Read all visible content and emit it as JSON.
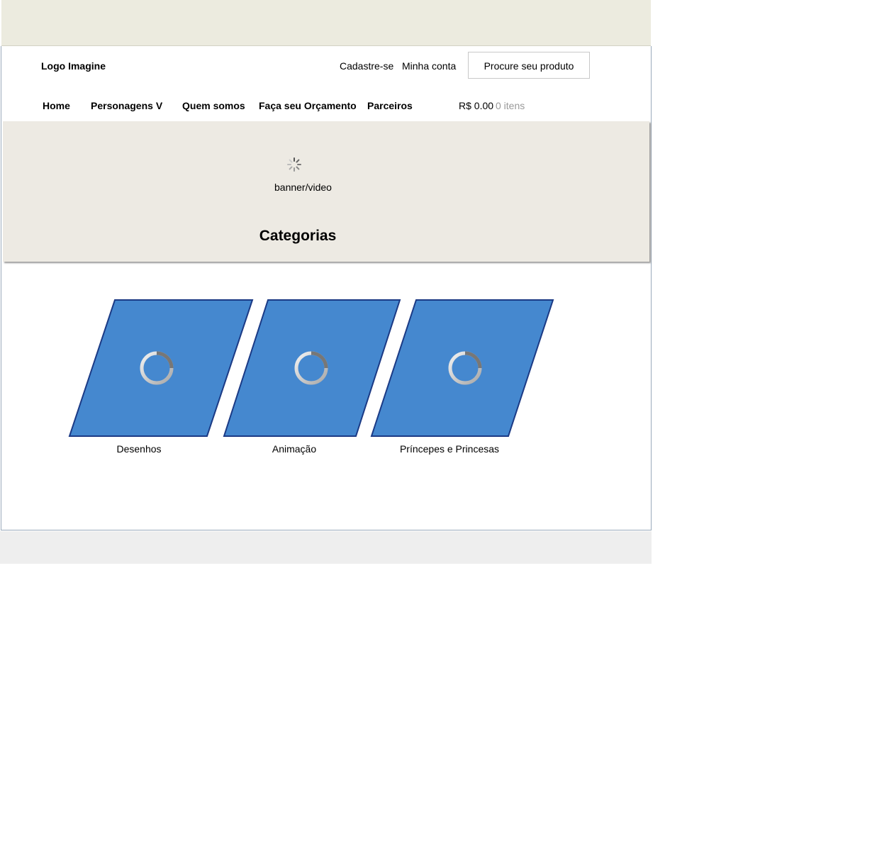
{
  "header": {
    "logo": "Logo Imagine",
    "links": {
      "signup": "Cadastre-se",
      "account": "Minha conta"
    },
    "search_placeholder": "Procure seu produto"
  },
  "nav": {
    "items": [
      "Home",
      "Personagens V",
      "Quem somos",
      "Faça seu Orçamento",
      "Parceiros"
    ],
    "cart_total": "R$ 0.00",
    "cart_count": "0 itens"
  },
  "banner": {
    "label": "banner/video"
  },
  "categories": {
    "title": "Categorias",
    "items": [
      "Desenhos",
      "Animação",
      "Príncepes e Princesas"
    ]
  },
  "colors": {
    "tile_fill": "#4588cf",
    "tile_border": "#1b3a85",
    "topbar": "#ecebdf",
    "banner": "#edeae3"
  }
}
